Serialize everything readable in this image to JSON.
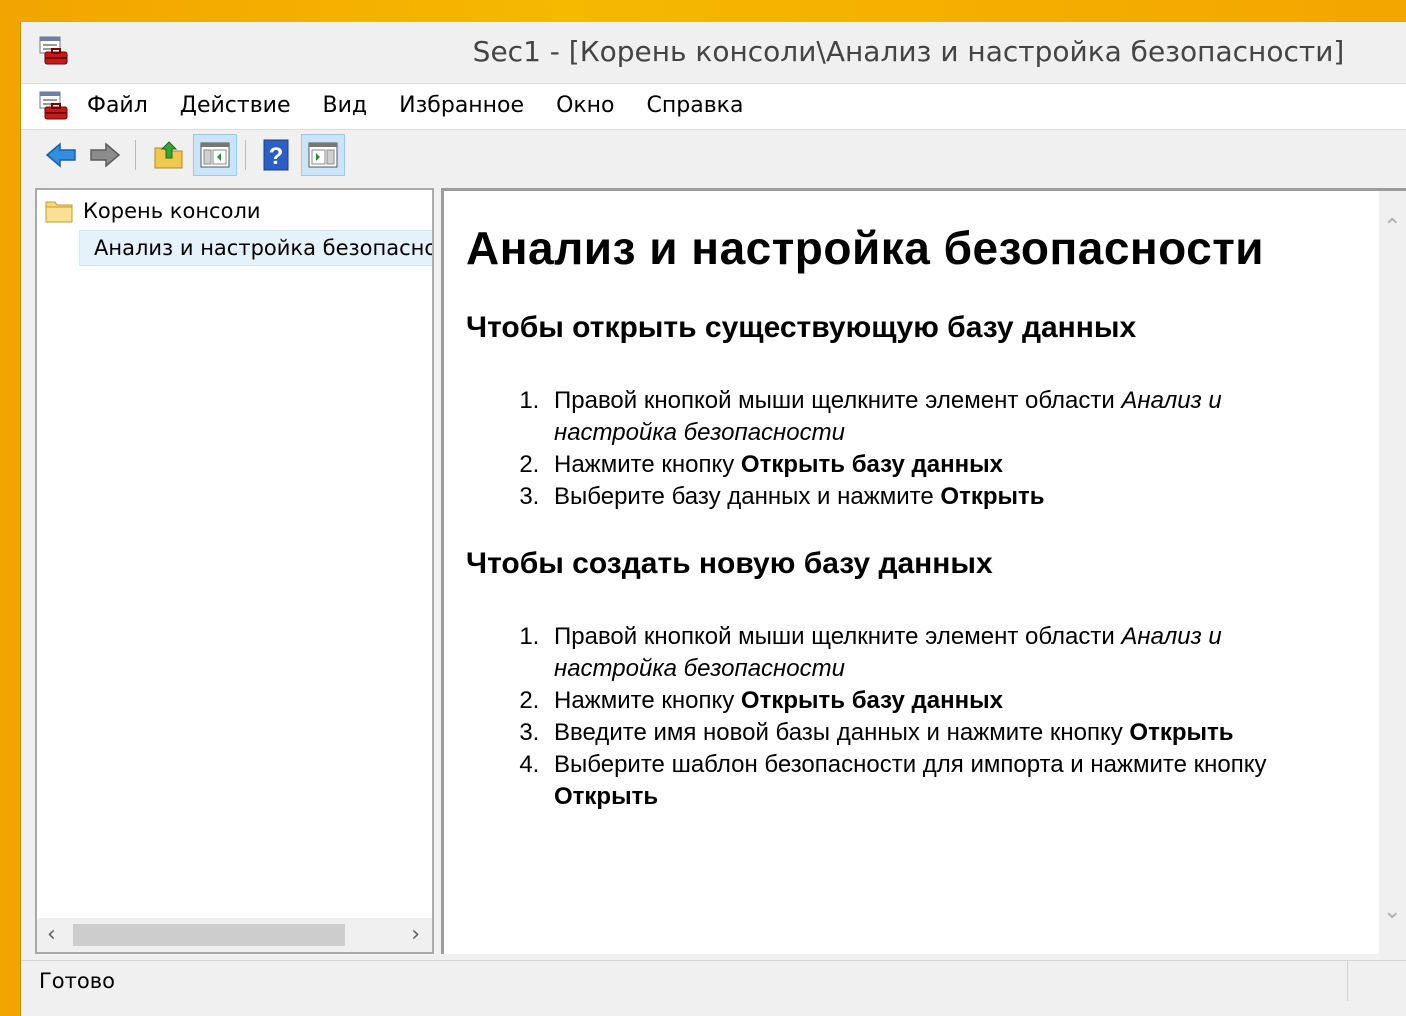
{
  "window": {
    "title": "Sec1 - [Корень консоли\\Анализ и настройка безопасности]"
  },
  "menu": {
    "items": [
      "Файл",
      "Действие",
      "Вид",
      "Избранное",
      "Окно",
      "Справка"
    ]
  },
  "toolbar": {
    "buttons": [
      "back-arrow-icon",
      "forward-arrow-icon",
      "up-folder-icon",
      "show-hide-tree-icon",
      "help-icon",
      "action-pane-icon"
    ]
  },
  "tree": {
    "root_label": "Корень консоли",
    "child_label": "Анализ и настройка безопасности"
  },
  "content": {
    "title": "Анализ и настройка безопасности",
    "section1": {
      "heading": "Чтобы открыть существующую базу данных",
      "step1_text": "Правой кнопкой мыши щелкните элемент области ",
      "step1_italic": "Анализ и настройка безопасности",
      "step2_text": "Нажмите кнопку ",
      "step2_bold": "Открыть базу данных",
      "step3_text": "Выберите базу данных и нажмите ",
      "step3_bold": "Открыть"
    },
    "section2": {
      "heading": "Чтобы создать новую базу данных",
      "step1_text": "Правой кнопкой мыши щелкните элемент области ",
      "step1_italic": "Анализ и настройка безопасности",
      "step2_text": "Нажмите кнопку ",
      "step2_bold": "Открыть базу данных",
      "step3_text": "Введите имя новой базы данных и нажмите кнопку ",
      "step3_bold": "Открыть",
      "step4_text": "Выберите шаблон безопасности для импорта и нажмите кнопку ",
      "step4_bold": "Открыть"
    }
  },
  "status": {
    "text": "Готово"
  },
  "colors": {
    "accent_bg": "#f7b800",
    "selection": "#e5f1fb",
    "toolbar_active": "#cce4f7"
  }
}
